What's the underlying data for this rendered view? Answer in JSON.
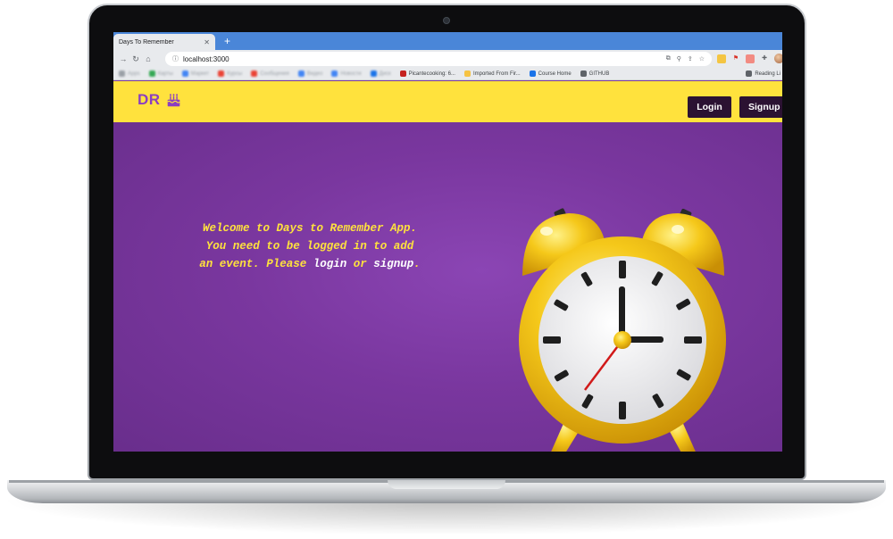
{
  "browser": {
    "tab_title": "Days To Remember",
    "url": "localhost:3000",
    "bookmarks": [
      {
        "label": "Apps",
        "color": "#9aa0a6",
        "blur": true
      },
      {
        "label": "Карты",
        "color": "#34a853",
        "blur": true
      },
      {
        "label": "Маркет",
        "color": "#4285f4",
        "blur": true
      },
      {
        "label": "Курсы",
        "color": "#ea4335",
        "blur": true
      },
      {
        "label": "Сообщения",
        "color": "#ea4335",
        "blur": true
      },
      {
        "label": "Видео",
        "color": "#4285f4",
        "blur": true
      },
      {
        "label": "Новости",
        "color": "#4285f4",
        "blur": true
      },
      {
        "label": "Диск",
        "color": "#1a73e8",
        "blur": true
      },
      {
        "label": "Picantecooking: 6...",
        "color": "#c5221f",
        "blur": false
      },
      {
        "label": "Imported From Fir...",
        "color": "#f6c343",
        "blur": false
      },
      {
        "label": "Course Home",
        "color": "#1a73e8",
        "blur": false
      },
      {
        "label": "GITHUB",
        "color": "#5f6368",
        "blur": false
      }
    ],
    "reading_list": "Reading Li"
  },
  "app": {
    "logo_text": "DR",
    "login_label": "Login",
    "signup_label": "Signup",
    "welcome_line1": "Welcome to Days to Remember App.",
    "welcome_line2": "You need to be logged in to add",
    "welcome_line3a": "an event. Please ",
    "welcome_login": "login",
    "welcome_or": " or ",
    "welcome_signup": "signup",
    "welcome_end": "."
  },
  "colors": {
    "header_yellow": "#ffe23d",
    "brand_purple": "#8b3fc0",
    "hero_purple": "#7a379f",
    "button_dark": "#2b1232"
  }
}
